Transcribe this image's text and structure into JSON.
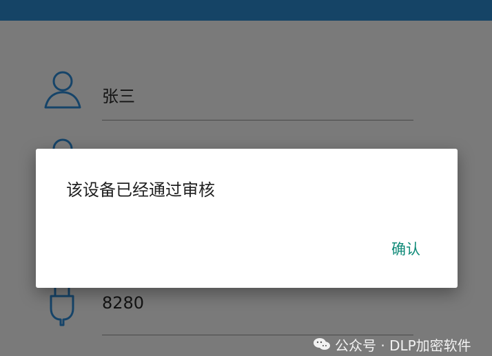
{
  "form": {
    "name_value": "张三",
    "port_value": "8280"
  },
  "dialog": {
    "message": "该设备已经通过审核",
    "confirm_label": "确认"
  },
  "watermark": {
    "text": "公众号 · DLP加密软件"
  },
  "icons": {
    "name_field_icon": "user-icon",
    "hidden_field_icon": "user-icon",
    "port_field_icon": "plug-icon",
    "watermark_icon": "wechat-icon"
  },
  "colors": {
    "header": "#2d8fd6",
    "icon": "#2f8fdc",
    "confirm_text": "#0f8a78",
    "overlay": "rgba(0,0,0,0.52)"
  }
}
